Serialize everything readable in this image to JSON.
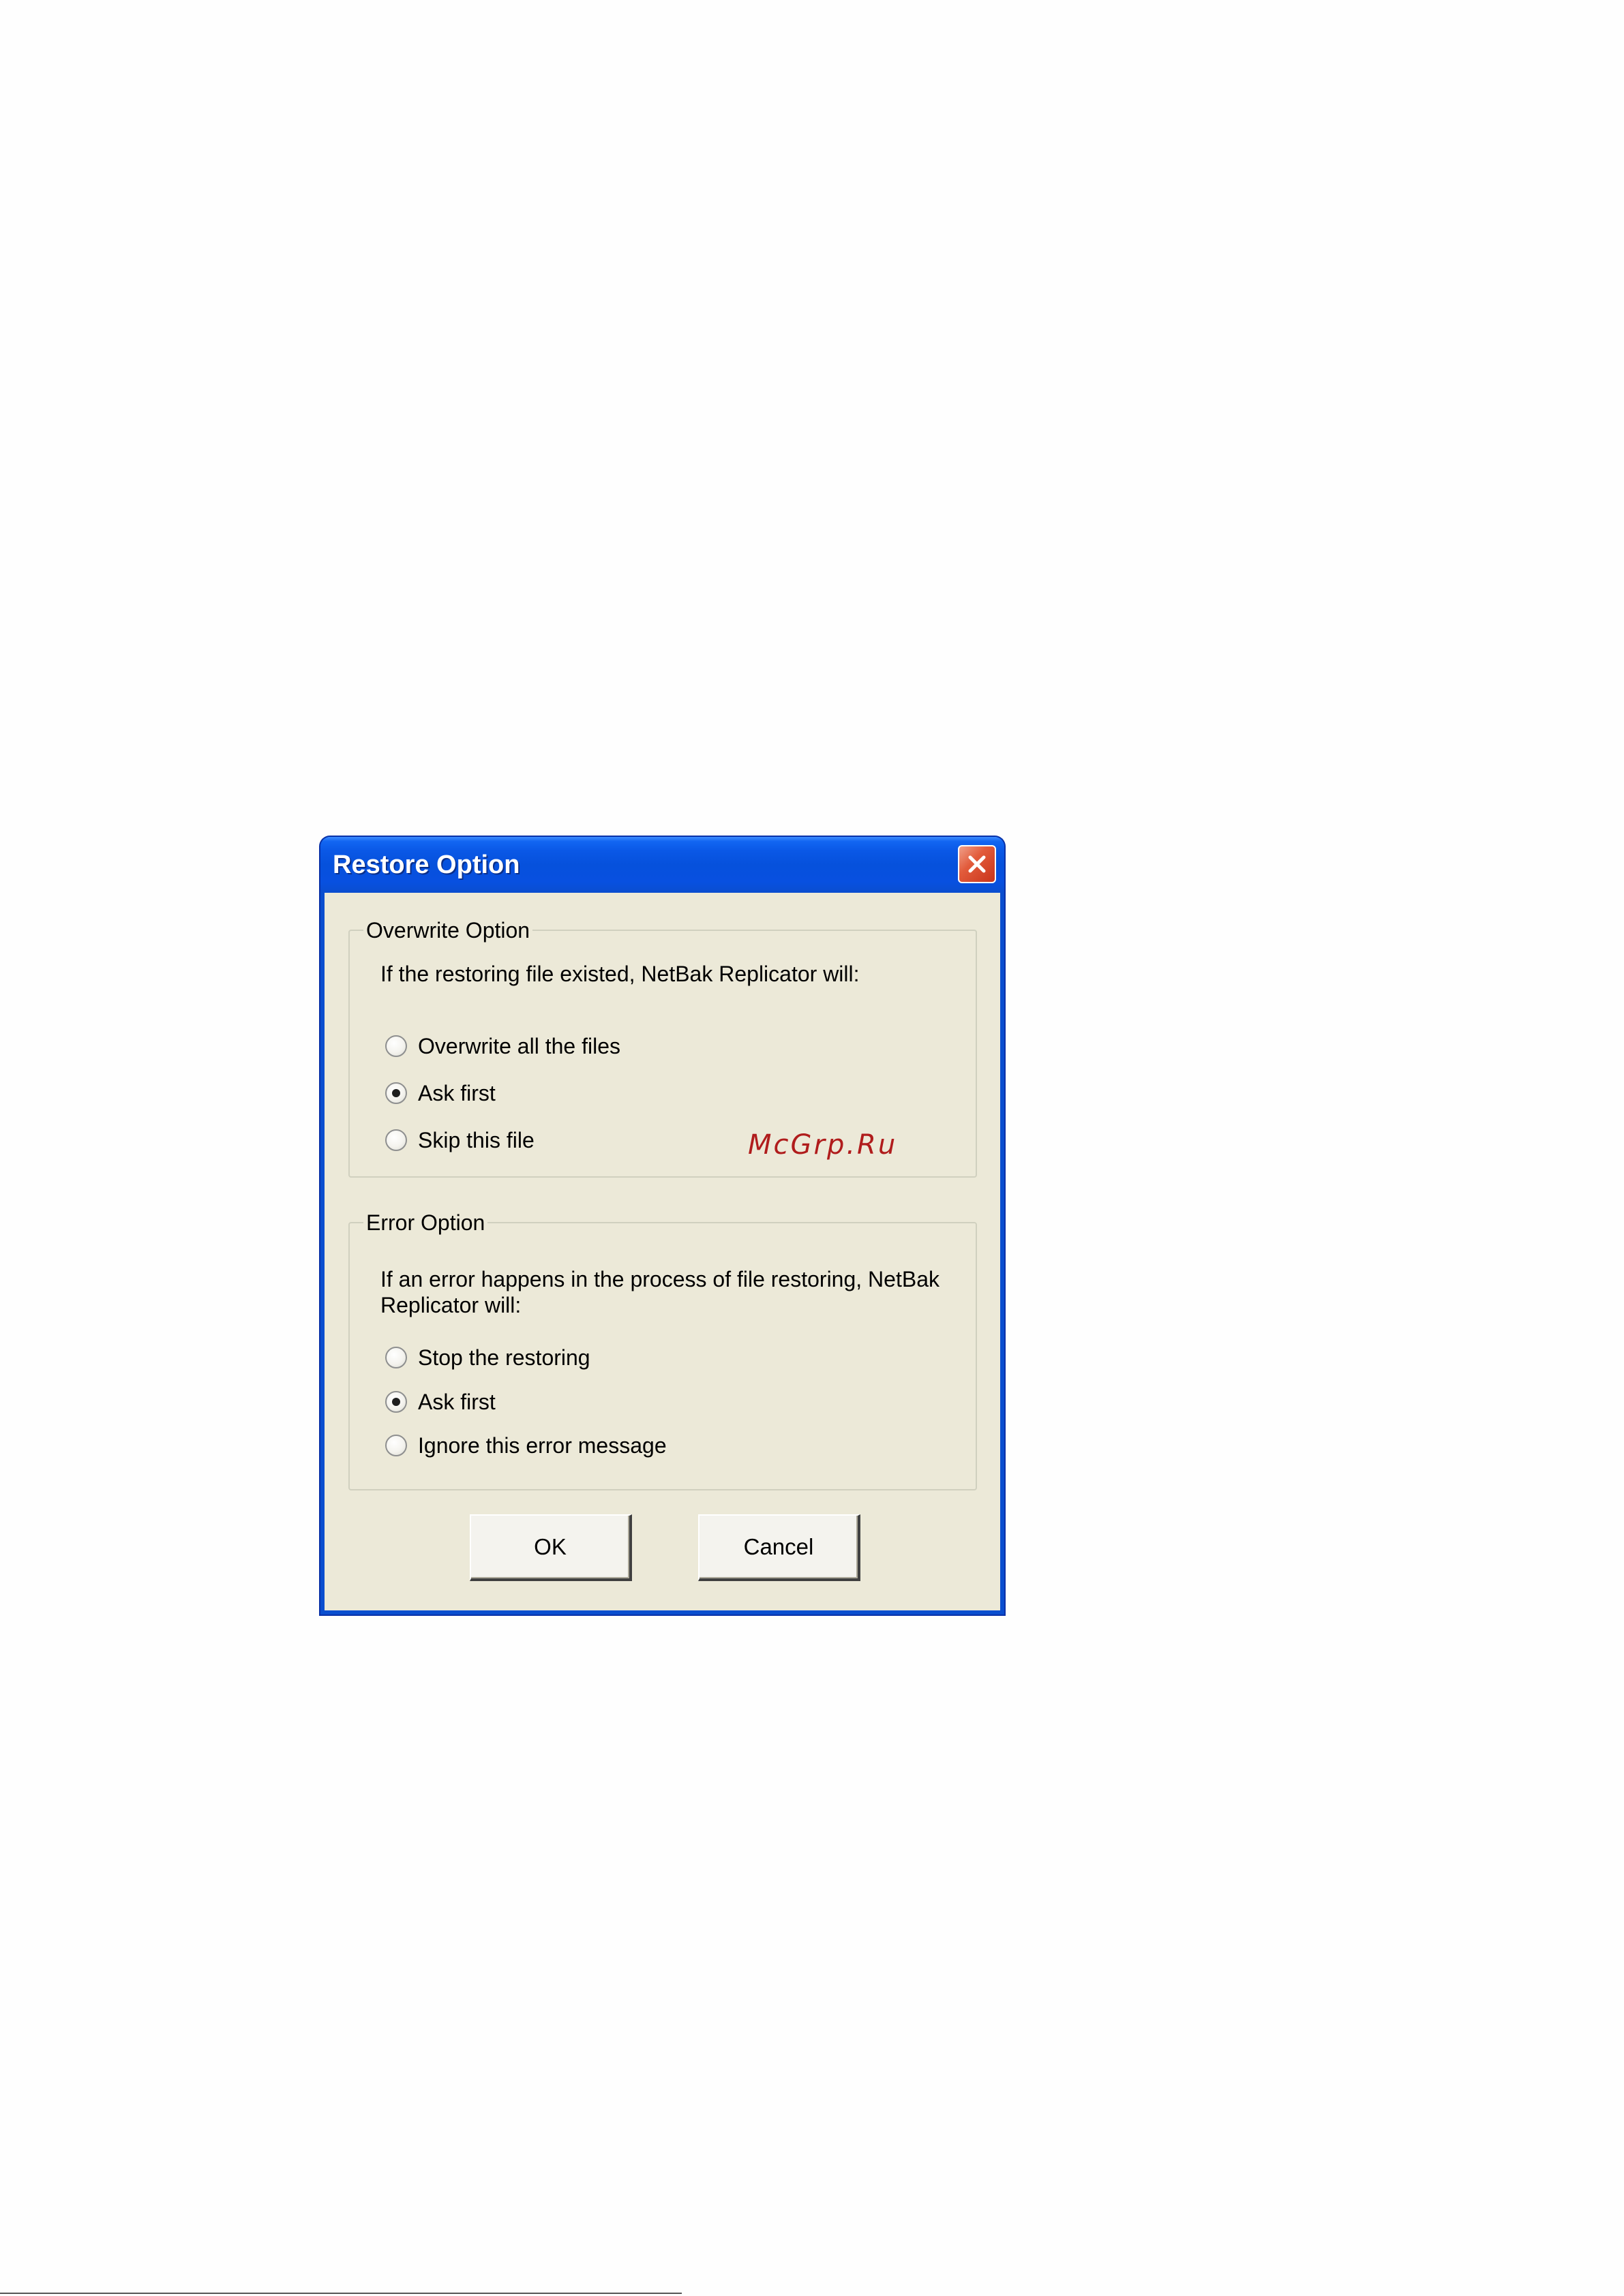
{
  "dialog": {
    "title": "Restore Option",
    "close_icon": "close-icon"
  },
  "overwrite_group": {
    "legend": "Overwrite Option",
    "description": "If the restoring file existed, NetBak Replicator will:",
    "options": [
      {
        "label": "Overwrite all the files",
        "selected": false
      },
      {
        "label": "Ask first",
        "selected": true
      },
      {
        "label": "Skip this file",
        "selected": false
      }
    ]
  },
  "error_group": {
    "legend": "Error Option",
    "description": "If an error happens in the process of file restoring, NetBak Replicator will:",
    "options": [
      {
        "label": "Stop the restoring",
        "selected": false
      },
      {
        "label": "Ask first",
        "selected": true
      },
      {
        "label": "Ignore this error message",
        "selected": false
      }
    ]
  },
  "buttons": {
    "ok_label": "OK",
    "cancel_label": "Cancel"
  },
  "watermark": "McGrp.Ru",
  "colors": {
    "title_bar": "#0a4ecf",
    "dialog_background": "#ece9d8",
    "close_button": "#e25b3b",
    "watermark": "#b01c1c"
  }
}
